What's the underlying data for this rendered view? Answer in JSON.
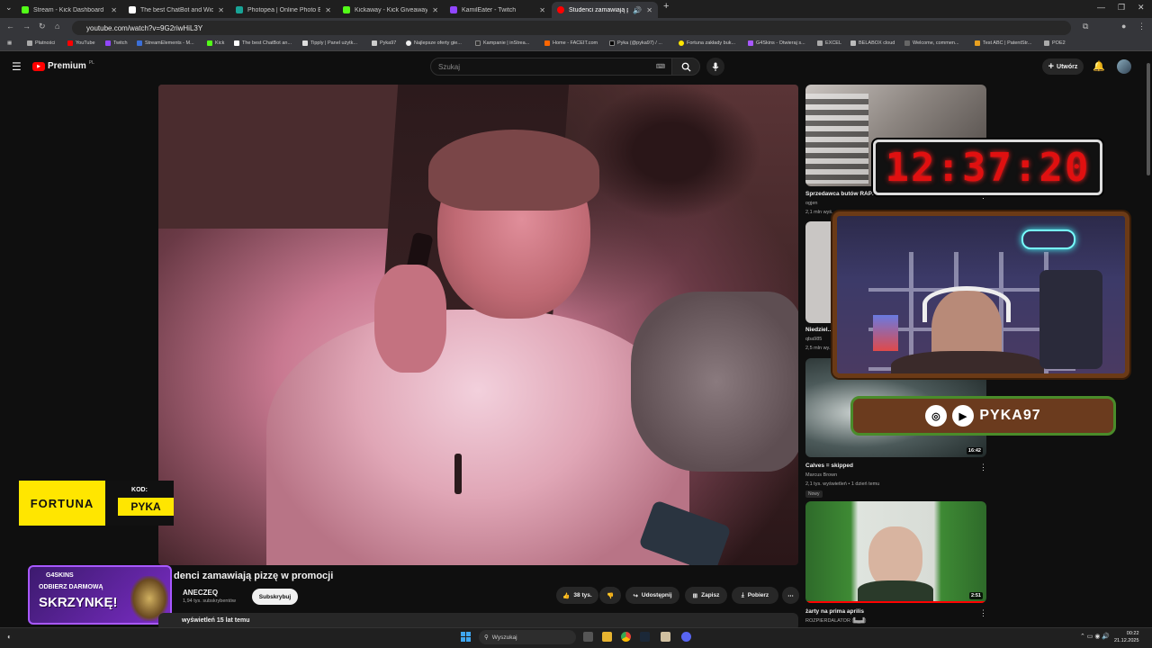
{
  "browser": {
    "tabs": [
      {
        "label": "Stream - Kick Dashboard",
        "color": "#53fc18"
      },
      {
        "label": "The best ChatBot and Widgets",
        "color": "#ffffff"
      },
      {
        "label": "Photopea | Online Photo Editor",
        "color": "#18a497"
      },
      {
        "label": "Kickaway - Kick Giveaway Tool",
        "color": "#53fc18"
      },
      {
        "label": "KamilEater - Twitch",
        "color": "#9146ff"
      },
      {
        "label": "Studenci zamawiają pizzę w",
        "color": "#ff0000"
      }
    ],
    "url": "youtube.com/watch?v=9G2riwHiL3Y",
    "bookmarks": [
      "Płatności",
      "YouTube",
      "Twitch",
      "StreamElements - M...",
      "Kick",
      "The best ChatBot an...",
      "Tipply | Panel użytk...",
      "Pyka97",
      "Najlepsze oferty gie...",
      "Kampanie | inStrea...",
      "Home - FACEIT.com",
      "Pyka (@pyka97) / ...",
      "Fortuna zakłady buk...",
      "G4Skins - Otwieraj s...",
      "EXCEL",
      "BELABOX cloud",
      "Welcome, commen...",
      "Test ABC | PatentStr...",
      "POE2"
    ]
  },
  "youtube": {
    "logo_text": "Premium",
    "logo_sup": "PL",
    "search_placeholder": "Szukaj",
    "create_label": "Utwórz"
  },
  "video": {
    "title": "Studenci zamawiają pizzę w promocji",
    "title_visible": "denci zamawiają pizzę w promocji",
    "channel": "ANECZEQ",
    "subscribers": "1,94 tys. subskrybentów",
    "subscribe_label": "Subskrybuj",
    "likes": "38 tys.",
    "share_label": "Udostępnij",
    "save_label": "Zapisz",
    "download_label": "Pobierz",
    "views_line": "wyświetleń  15 lat temu"
  },
  "sidebar": [
    {
      "title": "Sprzedawca butów RAPER",
      "channel": "ogjen",
      "meta": "2,1 mln wyś...",
      "duration": ""
    },
    {
      "title": "Niedziel...",
      "channel": "qba985",
      "meta": "2,5 mln wy...",
      "duration": ""
    },
    {
      "title": "Calves = skipped",
      "channel": "Marcus Brown",
      "meta": "2,1 tys. wyświetleń • 1 dzień temu",
      "duration": "16:42",
      "badge": "Nowy"
    },
    {
      "title": "żarty na prima aprilis",
      "channel": "ROZPIERDALATOR (▙▄▟)",
      "meta": "",
      "duration": "2:51"
    }
  ],
  "overlays": {
    "timer": "12:37:20",
    "social_handle": "PYKA97",
    "fortuna_brand": "FORTUNA",
    "fortuna_code_label": "KOD:",
    "fortuna_code": "PYKA",
    "g4_brand": "G4SKINS",
    "g4_line1": "ODBIERZ DARMOWĄ",
    "g4_line2": "SKRZYNKĘ!"
  },
  "taskbar": {
    "search_label": "Wyszukaj",
    "time": "00:22",
    "date": "21.12.2025"
  }
}
